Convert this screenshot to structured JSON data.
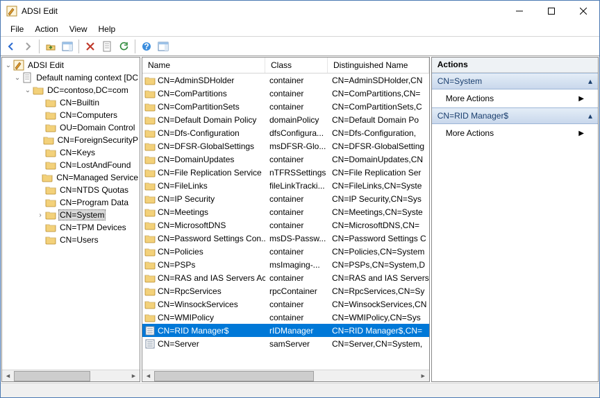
{
  "window": {
    "title": "ADSI Edit"
  },
  "menubar": [
    "File",
    "Action",
    "View",
    "Help"
  ],
  "tree": {
    "root": "ADSI Edit",
    "context": "Default naming context [DC",
    "domain": "DC=contoso,DC=com",
    "nodes": [
      "CN=Builtin",
      "CN=Computers",
      "OU=Domain Control",
      "CN=ForeignSecurityP",
      "CN=Keys",
      "CN=LostAndFound",
      "CN=Managed Service",
      "CN=NTDS Quotas",
      "CN=Program Data"
    ],
    "selected": "CN=System",
    "after": [
      "CN=TPM Devices",
      "CN=Users"
    ]
  },
  "list": {
    "columns": {
      "name": "Name",
      "class": "Class",
      "dn": "Distinguished Name"
    },
    "rows": [
      {
        "name": "CN=AdminSDHolder",
        "class": "container",
        "dn": "CN=AdminSDHolder,CN",
        "icon": "folder"
      },
      {
        "name": "CN=ComPartitions",
        "class": "container",
        "dn": "CN=ComPartitions,CN=",
        "icon": "folder"
      },
      {
        "name": "CN=ComPartitionSets",
        "class": "container",
        "dn": "CN=ComPartitionSets,C",
        "icon": "folder"
      },
      {
        "name": "CN=Default Domain Policy",
        "class": "domainPolicy",
        "dn": "CN=Default Domain Po",
        "icon": "folder"
      },
      {
        "name": "CN=Dfs-Configuration",
        "class": "dfsConfigura...",
        "dn": "CN=Dfs-Configuration,",
        "icon": "folder"
      },
      {
        "name": "CN=DFSR-GlobalSettings",
        "class": "msDFSR-Glo...",
        "dn": "CN=DFSR-GlobalSetting",
        "icon": "folder"
      },
      {
        "name": "CN=DomainUpdates",
        "class": "container",
        "dn": "CN=DomainUpdates,CN",
        "icon": "folder"
      },
      {
        "name": "CN=File Replication Service",
        "class": "nTFRSSettings",
        "dn": "CN=File Replication Ser",
        "icon": "folder"
      },
      {
        "name": "CN=FileLinks",
        "class": "fileLinkTracki...",
        "dn": "CN=FileLinks,CN=Syste",
        "icon": "folder"
      },
      {
        "name": "CN=IP Security",
        "class": "container",
        "dn": "CN=IP Security,CN=Sys",
        "icon": "folder"
      },
      {
        "name": "CN=Meetings",
        "class": "container",
        "dn": "CN=Meetings,CN=Syste",
        "icon": "folder"
      },
      {
        "name": "CN=MicrosoftDNS",
        "class": "container",
        "dn": "CN=MicrosoftDNS,CN=",
        "icon": "folder"
      },
      {
        "name": "CN=Password Settings Con...",
        "class": "msDS-Passw...",
        "dn": "CN=Password Settings C",
        "icon": "folder"
      },
      {
        "name": "CN=Policies",
        "class": "container",
        "dn": "CN=Policies,CN=System",
        "icon": "folder"
      },
      {
        "name": "CN=PSPs",
        "class": "msImaging-...",
        "dn": "CN=PSPs,CN=System,D",
        "icon": "folder"
      },
      {
        "name": "CN=RAS and IAS Servers Ac...",
        "class": "container",
        "dn": "CN=RAS and IAS Servers",
        "icon": "folder"
      },
      {
        "name": "CN=RpcServices",
        "class": "rpcContainer",
        "dn": "CN=RpcServices,CN=Sy",
        "icon": "folder"
      },
      {
        "name": "CN=WinsockServices",
        "class": "container",
        "dn": "CN=WinsockServices,CN",
        "icon": "folder"
      },
      {
        "name": "CN=WMIPolicy",
        "class": "container",
        "dn": "CN=WMIPolicy,CN=Sys",
        "icon": "folder"
      },
      {
        "name": "CN=RID Manager$",
        "class": "rIDManager",
        "dn": "CN=RID Manager$,CN=",
        "icon": "obj",
        "selected": true
      },
      {
        "name": "CN=Server",
        "class": "samServer",
        "dn": "CN=Server,CN=System,",
        "icon": "obj"
      }
    ]
  },
  "actions": {
    "heading": "Actions",
    "s1": {
      "title": "CN=System",
      "item": "More Actions"
    },
    "s2": {
      "title": "CN=RID Manager$",
      "item": "More Actions"
    }
  }
}
